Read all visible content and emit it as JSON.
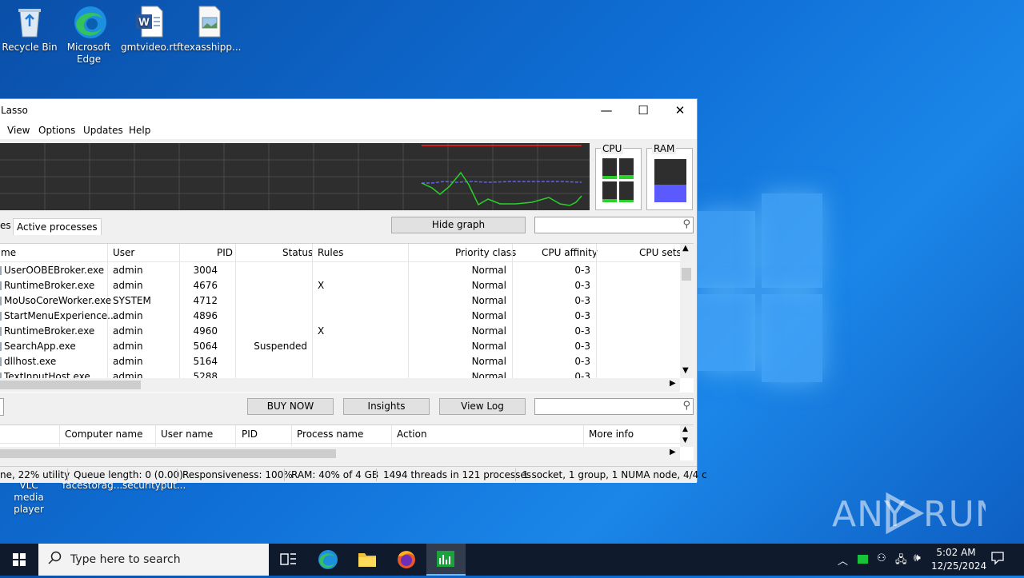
{
  "desktop": {
    "icons": [
      {
        "label": "Recycle Bin"
      },
      {
        "label": "Microsoft Edge"
      },
      {
        "label": "gmtvideo.rtf"
      },
      {
        "label": "texasshipp..."
      }
    ],
    "partial_labels": [
      "VLC media player",
      "facestorag...",
      "securityput..."
    ]
  },
  "window": {
    "title": "Lasso",
    "minimize": "—",
    "maximize": "☐",
    "close": "✕",
    "menu": [
      "View",
      "Options",
      "Updates",
      "Help"
    ],
    "meters": {
      "cpu_label": "CPU",
      "ram_label": "RAM",
      "ram_fill": 0.4
    },
    "tabs": {
      "partial": "es",
      "active": "Active processes"
    },
    "hide_graph": "Hide graph",
    "process_table": {
      "columns": [
        "me",
        "User",
        "PID",
        "Status",
        "Rules",
        "Priority class",
        "CPU affinity",
        "CPU sets"
      ],
      "rows": [
        {
          "name": "UserOOBEBroker.exe",
          "user": "admin",
          "pid": "3004",
          "status": "",
          "rules": "",
          "priority": "Normal",
          "affinity": "0-3"
        },
        {
          "name": "RuntimeBroker.exe",
          "user": "admin",
          "pid": "4676",
          "status": "",
          "rules": "X",
          "priority": "Normal",
          "affinity": "0-3"
        },
        {
          "name": "MoUsoCoreWorker.exe",
          "user": "SYSTEM",
          "pid": "4712",
          "status": "",
          "rules": "",
          "priority": "Normal",
          "affinity": "0-3"
        },
        {
          "name": "StartMenuExperience...",
          "user": "admin",
          "pid": "4896",
          "status": "",
          "rules": "",
          "priority": "Normal",
          "affinity": "0-3"
        },
        {
          "name": "RuntimeBroker.exe",
          "user": "admin",
          "pid": "4960",
          "status": "",
          "rules": "X",
          "priority": "Normal",
          "affinity": "0-3"
        },
        {
          "name": "SearchApp.exe",
          "user": "admin",
          "pid": "5064",
          "status": "Suspended",
          "rules": "",
          "priority": "Normal",
          "affinity": "0-3"
        },
        {
          "name": "dllhost.exe",
          "user": "admin",
          "pid": "5164",
          "status": "",
          "rules": "",
          "priority": "Normal",
          "affinity": "0-3"
        },
        {
          "name": "TextInputHost.exe",
          "user": "admin",
          "pid": "5288",
          "status": "",
          "rules": "",
          "priority": "Normal",
          "affinity": "0-3"
        }
      ]
    },
    "buttons": {
      "buy_now": "BUY NOW",
      "insights": "Insights",
      "view_log": "View Log"
    },
    "log_table": {
      "columns": [
        "Computer name",
        "User name",
        "PID",
        "Process name",
        "Action",
        "More info"
      ]
    },
    "status_bar": {
      "utility": "ne, 22% utility",
      "queue": "Queue length: 0 (0.00)",
      "responsiveness": "Responsiveness: 100%",
      "ram": "RAM: 40% of 4 GB",
      "threads": "1494 threads in 121 processes",
      "topology": "1 socket, 1 group, 1 NUMA node, 4/4 c"
    }
  },
  "taskbar": {
    "search_placeholder": "Type here to search",
    "time": "5:02 AM",
    "date": "12/25/2024"
  },
  "watermark": "ANY RUN",
  "colors": {
    "graph_bg": "#2e2e2e",
    "cpu_line": "#2bd12b",
    "ram_line": "#6060ff",
    "limit_line": "#d02020",
    "accent": "#0078d7"
  }
}
